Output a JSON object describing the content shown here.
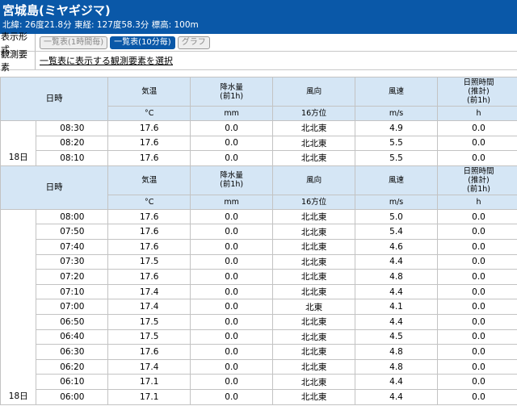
{
  "station": {
    "name": "宮城島(ミヤギジマ)",
    "location": "北緯: 26度21.8分 東経: 127度58.3分 標高: 100m"
  },
  "display_format": {
    "label": "表示形式",
    "buttons": [
      {
        "label": "一覧表(1時間毎)",
        "active": false
      },
      {
        "label": "一覧表(10分毎)",
        "active": true
      },
      {
        "label": "グラフ",
        "active": false
      }
    ]
  },
  "elements": {
    "label": "観測要素",
    "link": "一覧表に表示する観測要素を選択"
  },
  "table": {
    "date_header": "日時",
    "columns": [
      {
        "name": "気温",
        "unit": "°C"
      },
      {
        "name": "降水量\n(前1h)",
        "unit": "mm"
      },
      {
        "name": "風向",
        "unit": "16方位"
      },
      {
        "name": "風速",
        "unit": "m/s"
      },
      {
        "name": "日照時間\n(推計)\n(前1h)",
        "unit": "h"
      }
    ],
    "groups": [
      {
        "date": "18日",
        "rows": [
          {
            "time": "08:30",
            "temp": "17.6",
            "precip": "0.0",
            "wind_dir": "北北東",
            "wind_speed": "4.9",
            "sunshine": "0.0"
          },
          {
            "time": "08:20",
            "temp": "17.6",
            "precip": "0.0",
            "wind_dir": "北北東",
            "wind_speed": "5.5",
            "sunshine": "0.0"
          },
          {
            "time": "08:10",
            "temp": "17.6",
            "precip": "0.0",
            "wind_dir": "北北東",
            "wind_speed": "5.5",
            "sunshine": "0.0"
          }
        ]
      },
      {
        "date": "18日",
        "rows": [
          {
            "time": "08:00",
            "temp": "17.6",
            "precip": "0.0",
            "wind_dir": "北北東",
            "wind_speed": "5.0",
            "sunshine": "0.0"
          },
          {
            "time": "07:50",
            "temp": "17.6",
            "precip": "0.0",
            "wind_dir": "北北東",
            "wind_speed": "5.4",
            "sunshine": "0.0"
          },
          {
            "time": "07:40",
            "temp": "17.6",
            "precip": "0.0",
            "wind_dir": "北北東",
            "wind_speed": "4.6",
            "sunshine": "0.0"
          },
          {
            "time": "07:30",
            "temp": "17.5",
            "precip": "0.0",
            "wind_dir": "北北東",
            "wind_speed": "4.4",
            "sunshine": "0.0"
          },
          {
            "time": "07:20",
            "temp": "17.6",
            "precip": "0.0",
            "wind_dir": "北北東",
            "wind_speed": "4.8",
            "sunshine": "0.0"
          },
          {
            "time": "07:10",
            "temp": "17.4",
            "precip": "0.0",
            "wind_dir": "北北東",
            "wind_speed": "4.4",
            "sunshine": "0.0"
          },
          {
            "time": "07:00",
            "temp": "17.4",
            "precip": "0.0",
            "wind_dir": "北東",
            "wind_speed": "4.1",
            "sunshine": "0.0"
          },
          {
            "time": "06:50",
            "temp": "17.5",
            "precip": "0.0",
            "wind_dir": "北北東",
            "wind_speed": "4.4",
            "sunshine": "0.0"
          },
          {
            "time": "06:40",
            "temp": "17.5",
            "precip": "0.0",
            "wind_dir": "北北東",
            "wind_speed": "4.5",
            "sunshine": "0.0"
          },
          {
            "time": "06:30",
            "temp": "17.6",
            "precip": "0.0",
            "wind_dir": "北北東",
            "wind_speed": "4.8",
            "sunshine": "0.0"
          },
          {
            "time": "06:20",
            "temp": "17.4",
            "precip": "0.0",
            "wind_dir": "北北東",
            "wind_speed": "4.8",
            "sunshine": "0.0"
          },
          {
            "time": "06:10",
            "temp": "17.1",
            "precip": "0.0",
            "wind_dir": "北北東",
            "wind_speed": "4.4",
            "sunshine": "0.0"
          },
          {
            "time": "06:00",
            "temp": "17.1",
            "precip": "0.0",
            "wind_dir": "北北東",
            "wind_speed": "4.4",
            "sunshine": "0.0"
          }
        ]
      }
    ]
  }
}
